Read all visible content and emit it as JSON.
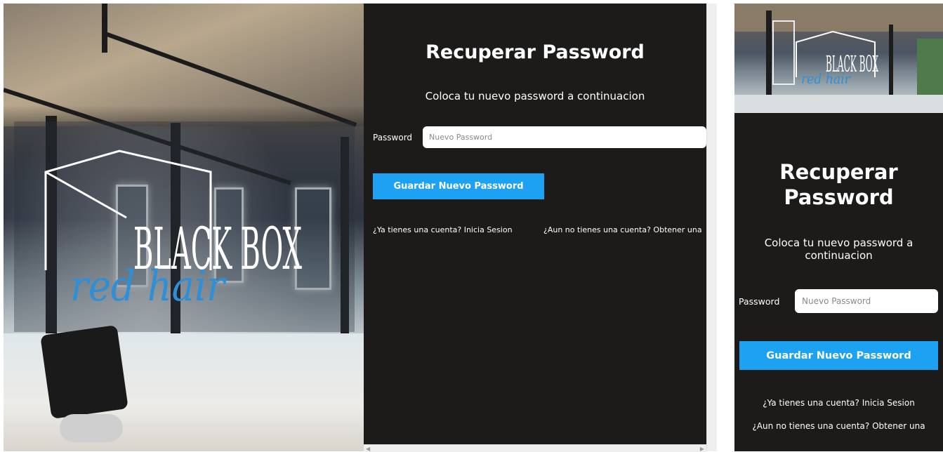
{
  "hero": {
    "logo_line1": "BLACK BOX",
    "logo_line2": "red hair"
  },
  "form": {
    "title": "Recuperar Password",
    "subtitle": "Coloca tu nuevo password a continuacion",
    "password_label": "Password",
    "password_placeholder": "Nuevo Password",
    "submit_label": "Guardar Nuevo Password",
    "link_login": "¿Ya tienes una cuenta? Inicia Sesion",
    "link_register": "¿Aun no tienes una cuenta? Obtener una"
  },
  "colors": {
    "panel_bg": "#1c1b19",
    "accent": "#1da1f2",
    "logo_script": "#2f8fd6"
  }
}
